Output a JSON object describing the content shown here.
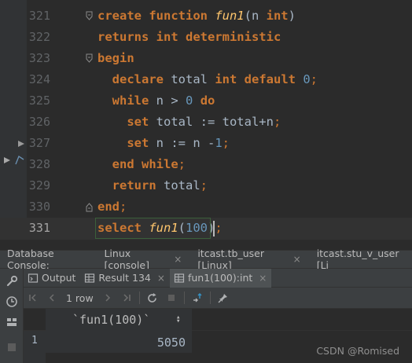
{
  "editor": {
    "lines": [
      {
        "num": "321",
        "parts": [
          [
            "kw",
            "create function "
          ],
          [
            "fn",
            "fun1"
          ],
          [
            "plain",
            "(n "
          ],
          [
            "kw",
            "int"
          ],
          [
            "plain",
            ")"
          ]
        ]
      },
      {
        "num": "322",
        "parts": [
          [
            "kw",
            "returns int deterministic"
          ]
        ]
      },
      {
        "num": "323",
        "parts": [
          [
            "kw",
            "begin"
          ]
        ]
      },
      {
        "num": "324",
        "parts": [
          [
            "plain",
            "  "
          ],
          [
            "kw",
            "declare"
          ],
          [
            "plain",
            " total "
          ],
          [
            "kw",
            "int default "
          ],
          [
            "num",
            "0"
          ],
          [
            "punc",
            ";"
          ]
        ]
      },
      {
        "num": "325",
        "parts": [
          [
            "plain",
            "  "
          ],
          [
            "kw",
            "while"
          ],
          [
            "plain",
            " n > "
          ],
          [
            "num",
            "0"
          ],
          [
            "plain",
            " "
          ],
          [
            "kw",
            "do"
          ]
        ]
      },
      {
        "num": "326",
        "parts": [
          [
            "plain",
            "    "
          ],
          [
            "kw",
            "set"
          ],
          [
            "plain",
            " total := total+n"
          ],
          [
            "punc",
            ";"
          ]
        ]
      },
      {
        "num": "327",
        "parts": [
          [
            "plain",
            "    "
          ],
          [
            "kw",
            "set"
          ],
          [
            "plain",
            " n := n -"
          ],
          [
            "num",
            "1"
          ],
          [
            "punc",
            ";"
          ]
        ]
      },
      {
        "num": "328",
        "parts": [
          [
            "plain",
            "  "
          ],
          [
            "kw",
            "end while"
          ],
          [
            "punc",
            ";"
          ]
        ]
      },
      {
        "num": "329",
        "parts": [
          [
            "plain",
            "  "
          ],
          [
            "kw",
            "return"
          ],
          [
            "plain",
            " total"
          ],
          [
            "punc",
            ";"
          ]
        ]
      },
      {
        "num": "330",
        "parts": [
          [
            "kw",
            "end"
          ],
          [
            "punc",
            ";"
          ]
        ]
      },
      {
        "num": "331",
        "parts": [
          [
            "kw",
            "select "
          ],
          [
            "fn",
            "fun1"
          ],
          [
            "plain",
            "("
          ],
          [
            "num",
            "100"
          ],
          [
            "plain",
            ")"
          ],
          [
            "punc",
            ";"
          ]
        ]
      }
    ]
  },
  "console_tabs": {
    "label": "Database Console:",
    "tabs": [
      {
        "label": "Linux [console]",
        "close": "×"
      },
      {
        "label": "itcast.tb_user [Linux]",
        "close": "×"
      },
      {
        "label": "itcast.stu_v_user [Li",
        "close": ""
      }
    ]
  },
  "result_tabs": {
    "tabs": [
      {
        "label": "Output",
        "icon": "output-icon",
        "close": ""
      },
      {
        "label": "Result 134",
        "icon": "table-icon",
        "close": "×"
      },
      {
        "label": "fun1(100):int",
        "icon": "table-icon",
        "close": "×"
      }
    ]
  },
  "toolbar": {
    "first": "|<",
    "prev": "<",
    "rows": "1 row",
    "next": ">",
    "last": ">|"
  },
  "grid": {
    "columns": [
      "`fun1(100)`"
    ],
    "rows": [
      {
        "num": "1",
        "values": [
          "5050"
        ]
      }
    ]
  },
  "watermark": "CSDN @Romised",
  "colors": {
    "keyword": "#cc7832",
    "function": "#ffc66d",
    "number": "#6897bb",
    "text": "#a9b7c6",
    "background": "#2b2b2b"
  }
}
